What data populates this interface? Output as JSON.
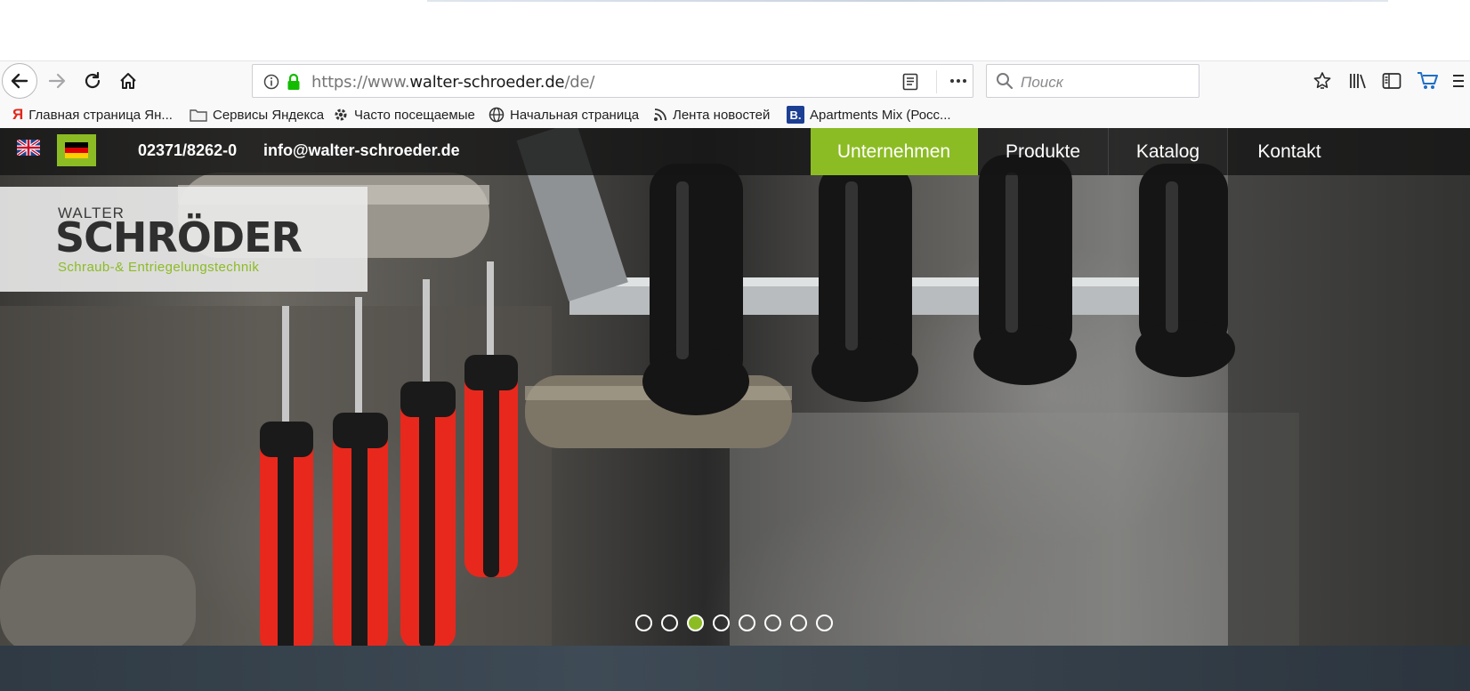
{
  "browser": {
    "url_prefix": "https://www.",
    "url_domain": "walter-schroeder.de",
    "url_path": "/de/",
    "search_placeholder": "Поиск"
  },
  "bookmarks": [
    {
      "label": "Главная страница Ян...",
      "icon": "yandex-icon"
    },
    {
      "label": "Сервисы Яндекса",
      "icon": "folder-icon"
    },
    {
      "label": "Часто посещаемые",
      "icon": "gear-icon"
    },
    {
      "label": "Начальная страница",
      "icon": "globe-icon"
    },
    {
      "label": "Лента новостей",
      "icon": "rss-icon"
    },
    {
      "label": "Apartments Mix (Росс...",
      "icon": "booking-icon"
    }
  ],
  "site": {
    "phone": "02371/8262-0",
    "email": "info@walter-schroeder.de",
    "menu": [
      {
        "label": "Unternehmen",
        "active": true
      },
      {
        "label": "Produkte",
        "active": false
      },
      {
        "label": "Katalog",
        "active": false
      },
      {
        "label": "Kontakt",
        "active": false
      }
    ],
    "logo": {
      "top": "WALTER",
      "name": "SCHRÖDER",
      "sub": "Schraub-& Entriegelungstechnik"
    },
    "slider": {
      "count": 8,
      "active_index": 2
    },
    "colors": {
      "accent": "#8cbc24",
      "bar": "#141414"
    }
  }
}
